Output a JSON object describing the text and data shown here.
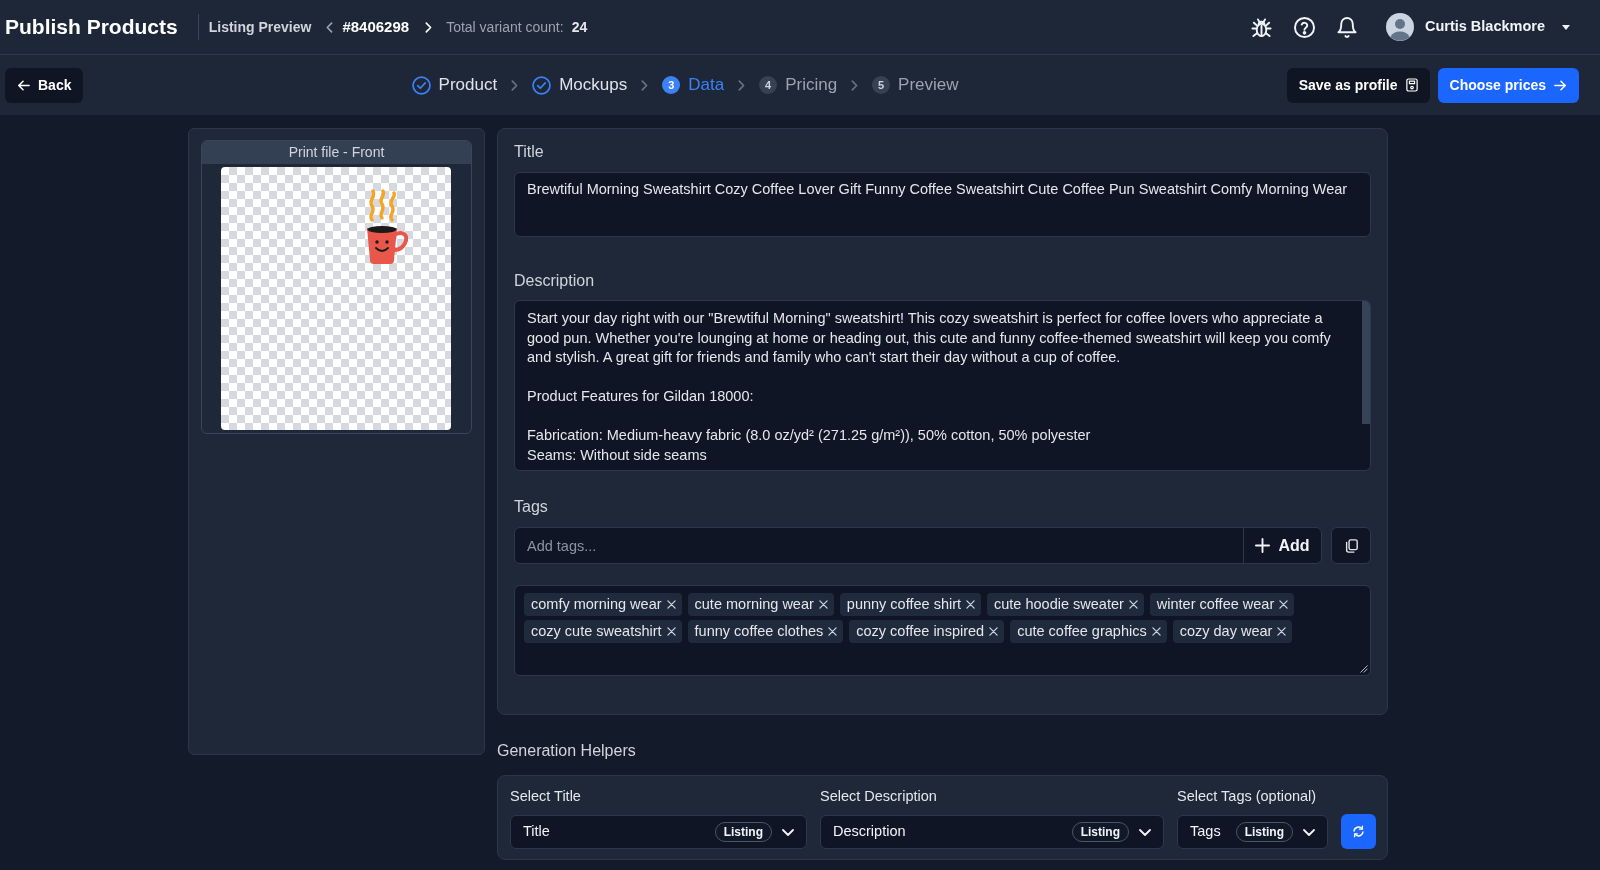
{
  "header": {
    "title": "Publish Products",
    "breadcrumb": "Listing Preview",
    "listing_id": "#8406298",
    "variant_count_label": "Total variant count:",
    "variant_count": "24",
    "user_name": "Curtis Blackmore"
  },
  "toolbar": {
    "back_button": "Back",
    "steps": [
      {
        "label": "Product",
        "done": true,
        "selected": false
      },
      {
        "label": "Mockups",
        "done": true,
        "selected": false
      },
      {
        "number": "3",
        "label": "Data",
        "done": false,
        "selected": true
      },
      {
        "number": "4",
        "label": "Pricing",
        "done": false,
        "selected": false
      },
      {
        "number": "5",
        "label": "Preview",
        "done": false,
        "selected": false
      }
    ],
    "save_button": "Save as profile",
    "next_button": "Choose prices"
  },
  "print_file": {
    "title": "Print file - Front"
  },
  "form": {
    "title": {
      "label": "Title",
      "value": "Brewtiful Morning Sweatshirt Cozy Coffee Lover Gift Funny Coffee Sweatshirt Cute Coffee Pun Sweatshirt Comfy Morning Wear"
    },
    "description": {
      "label": "Description",
      "value": "Start your day right with our \"Brewtiful Morning\" sweatshirt! This cozy sweatshirt is perfect for coffee lovers who appreciate a good pun. Whether you're lounging at home or heading out, this cute and funny coffee-themed sweatshirt will keep you comfy and stylish. A great gift for friends and family who can't start their day without a cup of coffee.\n\nProduct Features for Gildan 18000:\n\nFabrication: Medium-heavy fabric (8.0 oz/yd² (271.25 g/m²)), 50% cotton, 50% polyester\nSeams: Without side seams"
    },
    "tags": {
      "label": "Tags",
      "placeholder": "Add tags...",
      "add_button": "Add",
      "items": [
        "comfy morning wear",
        "cute morning wear",
        "punny coffee shirt",
        "cute hoodie sweater",
        "winter coffee wear",
        "cozy cute sweatshirt",
        "funny coffee clothes",
        "cozy coffee inspired",
        "cute coffee graphics",
        "cozy day wear"
      ]
    }
  },
  "generation_helpers": {
    "heading": "Generation Helpers",
    "selects": [
      {
        "label": "Select Title",
        "value": "Title",
        "badge": "Listing"
      },
      {
        "label": "Select Description",
        "value": "Description",
        "badge": "Listing"
      },
      {
        "label": "Select Tags (optional)",
        "value": "Tags",
        "badge": "Listing"
      }
    ]
  }
}
